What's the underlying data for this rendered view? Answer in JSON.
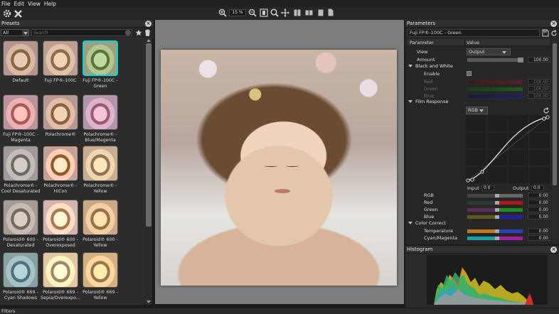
{
  "menu": [
    "File",
    "Edit",
    "View",
    "Help"
  ],
  "toolbar": {
    "zoom": "15 %"
  },
  "presets": {
    "title": "Presets",
    "filter_value": "All",
    "search_placeholder": "Search",
    "items": [
      [
        "Default"
      ],
      [
        "Fuji FP®-100C"
      ],
      [
        "Fuji FP®-100C -",
        "Green"
      ],
      [
        "Fuji FP®-100C -",
        "Magenta"
      ],
      [
        "Polachrome®"
      ],
      [
        "Polachrome® -",
        "Blue/Magenta"
      ],
      [
        "Polachrome® -",
        "Cool Desaturated"
      ],
      [
        "Polachrome® -",
        "HiCon"
      ],
      [
        "Polachrome® -",
        "Yellow"
      ],
      [
        "Polaroid® 600 -",
        "Desaturated"
      ],
      [
        "Polaroid® 600 -",
        "Overexposed"
      ],
      [
        "Polaroid® 600 -",
        "Yellow"
      ],
      [
        "Polaroid® 669 -",
        "Cyan Shadows"
      ],
      [
        "Polaroid® 669 -",
        "Sepia/Overexpo..."
      ],
      [
        "Polaroid® 669 -",
        "Yellow"
      ]
    ]
  },
  "filters": {
    "title": "Filters"
  },
  "parameters": {
    "title": "Parameters",
    "preset_name": "Fuji FP®-100C - Green",
    "col_parameter": "Parameter",
    "col_value": "Value",
    "view_label": "View",
    "view_value": "Output",
    "amount_label": "Amount",
    "amount_value": "100.00",
    "bw_label": "Black and White",
    "enable_label": "Enable",
    "bw_red": "Red",
    "bw_red_val": "100.00",
    "bw_green": "Green",
    "bw_green_val": "100.00",
    "bw_blue": "Blue",
    "bw_blue_val": "100.00",
    "film_label": "Film Response",
    "film_channel": "RGB",
    "input_label": "Input",
    "input_val": "0.0",
    "output_label": "Output",
    "output_val": "0.0",
    "rgb_label": "RGB",
    "rgb_val": "0.00",
    "red_label": "Red",
    "red_val": "0.00",
    "green_label": "Green",
    "green_val": "0.00",
    "blue_label": "Blue",
    "blue_val": "0.00",
    "cc_label": "Color Correct",
    "temp_label": "Temperature",
    "temp_val": "0.00",
    "cm_label": "Cyan/Magenta",
    "cm_val": "0.00"
  },
  "histogram": {
    "title": "Histogram"
  },
  "icons": [
    "gear-icon",
    "close-x-icon",
    "zoom-in-icon",
    "zoom-out-icon",
    "fit-icon",
    "pan-icon",
    "compare-icon",
    "star-icon",
    "trash-icon",
    "reset-icon"
  ]
}
